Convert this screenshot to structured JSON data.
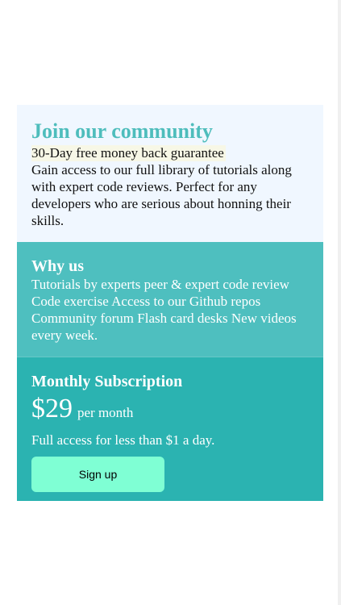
{
  "join": {
    "title": "Join our community",
    "guarantee": "30-Day free money back guarantee",
    "description": "Gain access to our full library of tutorials along with expert code reviews. Perfect for any developers who are serious about honning their skills."
  },
  "why": {
    "title": "Why us",
    "text": "Tutorials by experts peer & expert code review Code exercise Access to our Github repos Community forum Flash card desks New videos every week."
  },
  "subscription": {
    "title": "Monthly Subscription",
    "price": "$29",
    "period": "per month",
    "note": "Full access for less than $1 a day.",
    "button_label": "Sign up"
  },
  "colors": {
    "accent": "#4ebdbc",
    "top_bg": "#f0f7ff",
    "why_bg": "#4ebfbf",
    "subscription_bg": "#2bb3b1",
    "button_bg": "#7fffd4"
  }
}
